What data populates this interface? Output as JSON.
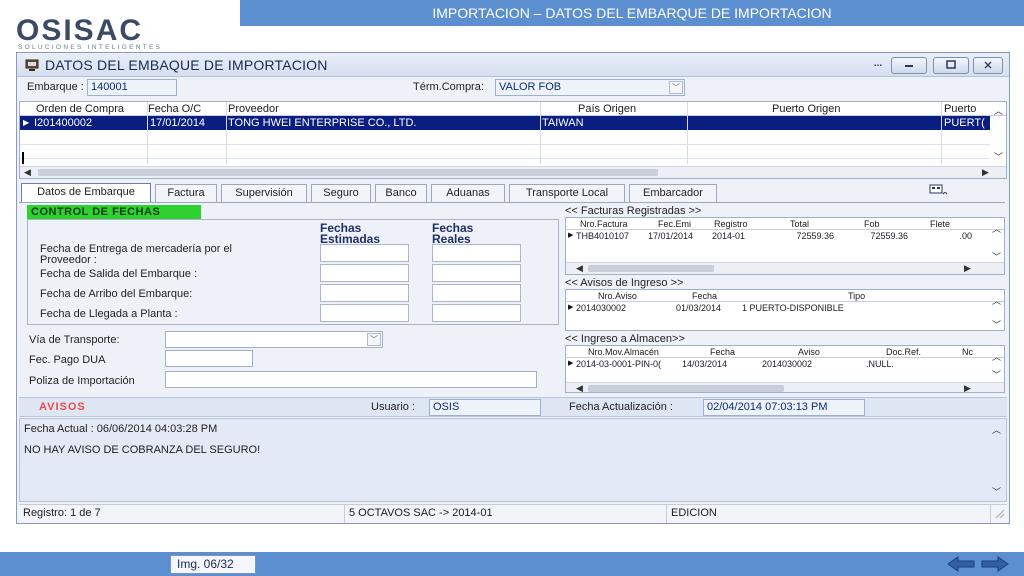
{
  "slide": {
    "banner": "IMPORTACION – DATOS DEL EMBARQUE DE IMPORTACION",
    "logo_text": "OSISAC",
    "logo_tagline": "SOLUCIONES INTELIGENTES",
    "img_counter": "Img. 06/32"
  },
  "window": {
    "title": "DATOS DEL EMBAQUE DE IMPORTACION",
    "menu_btn": "...",
    "embarque_label": "Embarque :",
    "embarque_value": "140001",
    "term_label": "Térm.Compra:",
    "term_value": "VALOR FOB"
  },
  "grid": {
    "columns": [
      "Orden de Compra",
      "Fecha O/C",
      "Proveedor",
      "País Origen",
      "Puerto Origen",
      "Puerto"
    ],
    "row": [
      "I201400002",
      "17/01/2014",
      "TONG HWEI ENTERPRISE CO., LTD.",
      "TAIWAN",
      "",
      "PUERT("
    ]
  },
  "tabs": [
    "Datos de Embarque",
    "Factura",
    "Supervisión",
    "Seguro",
    "Banco",
    "Aduanas",
    "Transporte Local",
    "Embarcador"
  ],
  "control": {
    "header": "CONTROL DE FECHAS",
    "col_est": "Fechas Estimadas",
    "col_real": "Fechas Reales",
    "rows": [
      "Fecha de Entrega de mercadería por el Proveedor :",
      "Fecha de Salida del Embarque :",
      "Fecha de Arribo del Embarque:",
      "Fecha de Llegada a Planta :"
    ],
    "via_label": "Vía de Transporte:",
    "dua_label": "Fec. Pago DUA",
    "poliza_label": "Poliza de Importación"
  },
  "facturas": {
    "title": "<< Facturas Registradas >>",
    "columns": [
      "Nro.Factura",
      "Fec.Emi",
      "Registro",
      "Total",
      "Fob",
      "Flete"
    ],
    "row": [
      "THB4010107",
      "17/01/2014",
      "2014-01",
      "72559.36",
      "72559.36",
      ".00"
    ]
  },
  "avisos_ingreso": {
    "title": "<< Avisos de Ingreso >>",
    "columns": [
      "Nro.Aviso",
      "Fecha",
      "Tipo"
    ],
    "row": [
      "2014030002",
      "01/03/2014",
      "1 PUERTO-DISPONIBLE"
    ]
  },
  "almacen": {
    "title": "<< Ingreso a Almacen>>",
    "columns": [
      "Nro.Mov.Almacén",
      "Fecha",
      "Aviso",
      "Doc.Ref.",
      "Nc"
    ],
    "row": [
      "2014-03-0001-PIN-0(",
      "14/03/2014",
      "2014030002",
      ".NULL.",
      ""
    ]
  },
  "avisos_bar": {
    "label": "AVISOS",
    "usuario_label": "Usuario :",
    "usuario_value": "OSIS",
    "fecha_label": "Fecha Actualización :",
    "fecha_value": "02/04/2014 07:03:13 PM"
  },
  "notes": {
    "line1": "Fecha Actual  : 06/06/2014 04:03:28 PM",
    "line2": "NO HAY AVISO DE COBRANZA DEL SEGURO!"
  },
  "status": {
    "registro": "Registro: 1 de 7",
    "empresa": "5 OCTAVOS SAC -> 2014-01",
    "modo": "EDICION"
  },
  "colors": {
    "banner": "#5b8fd0",
    "selection": "#0a1e82",
    "control_header": "#2fd12f",
    "avisos": "#e84c4c"
  },
  "icons": [
    "monitor-icon",
    "binoculars-icon",
    "scroll-arrow-icons",
    "nav-arrow-icons"
  ]
}
